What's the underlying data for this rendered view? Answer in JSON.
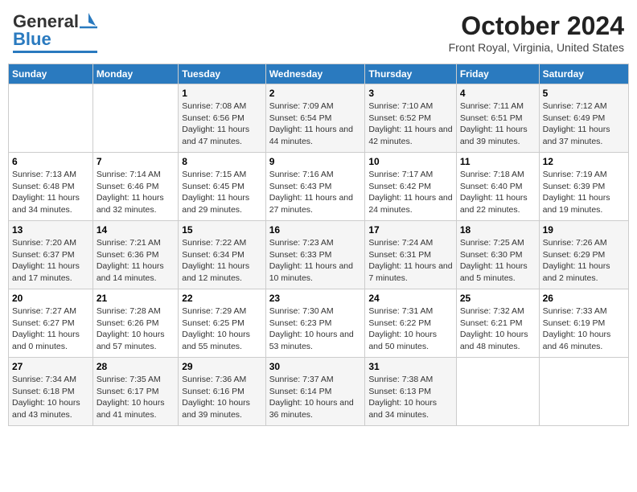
{
  "header": {
    "logo_line1": "General",
    "logo_line2": "Blue",
    "title": "October 2024",
    "subtitle": "Front Royal, Virginia, United States"
  },
  "days_of_week": [
    "Sunday",
    "Monday",
    "Tuesday",
    "Wednesday",
    "Thursday",
    "Friday",
    "Saturday"
  ],
  "weeks": [
    [
      {
        "num": "",
        "content": ""
      },
      {
        "num": "",
        "content": ""
      },
      {
        "num": "1",
        "content": "Sunrise: 7:08 AM\nSunset: 6:56 PM\nDaylight: 11 hours and 47 minutes."
      },
      {
        "num": "2",
        "content": "Sunrise: 7:09 AM\nSunset: 6:54 PM\nDaylight: 11 hours and 44 minutes."
      },
      {
        "num": "3",
        "content": "Sunrise: 7:10 AM\nSunset: 6:52 PM\nDaylight: 11 hours and 42 minutes."
      },
      {
        "num": "4",
        "content": "Sunrise: 7:11 AM\nSunset: 6:51 PM\nDaylight: 11 hours and 39 minutes."
      },
      {
        "num": "5",
        "content": "Sunrise: 7:12 AM\nSunset: 6:49 PM\nDaylight: 11 hours and 37 minutes."
      }
    ],
    [
      {
        "num": "6",
        "content": "Sunrise: 7:13 AM\nSunset: 6:48 PM\nDaylight: 11 hours and 34 minutes."
      },
      {
        "num": "7",
        "content": "Sunrise: 7:14 AM\nSunset: 6:46 PM\nDaylight: 11 hours and 32 minutes."
      },
      {
        "num": "8",
        "content": "Sunrise: 7:15 AM\nSunset: 6:45 PM\nDaylight: 11 hours and 29 minutes."
      },
      {
        "num": "9",
        "content": "Sunrise: 7:16 AM\nSunset: 6:43 PM\nDaylight: 11 hours and 27 minutes."
      },
      {
        "num": "10",
        "content": "Sunrise: 7:17 AM\nSunset: 6:42 PM\nDaylight: 11 hours and 24 minutes."
      },
      {
        "num": "11",
        "content": "Sunrise: 7:18 AM\nSunset: 6:40 PM\nDaylight: 11 hours and 22 minutes."
      },
      {
        "num": "12",
        "content": "Sunrise: 7:19 AM\nSunset: 6:39 PM\nDaylight: 11 hours and 19 minutes."
      }
    ],
    [
      {
        "num": "13",
        "content": "Sunrise: 7:20 AM\nSunset: 6:37 PM\nDaylight: 11 hours and 17 minutes."
      },
      {
        "num": "14",
        "content": "Sunrise: 7:21 AM\nSunset: 6:36 PM\nDaylight: 11 hours and 14 minutes."
      },
      {
        "num": "15",
        "content": "Sunrise: 7:22 AM\nSunset: 6:34 PM\nDaylight: 11 hours and 12 minutes."
      },
      {
        "num": "16",
        "content": "Sunrise: 7:23 AM\nSunset: 6:33 PM\nDaylight: 11 hours and 10 minutes."
      },
      {
        "num": "17",
        "content": "Sunrise: 7:24 AM\nSunset: 6:31 PM\nDaylight: 11 hours and 7 minutes."
      },
      {
        "num": "18",
        "content": "Sunrise: 7:25 AM\nSunset: 6:30 PM\nDaylight: 11 hours and 5 minutes."
      },
      {
        "num": "19",
        "content": "Sunrise: 7:26 AM\nSunset: 6:29 PM\nDaylight: 11 hours and 2 minutes."
      }
    ],
    [
      {
        "num": "20",
        "content": "Sunrise: 7:27 AM\nSunset: 6:27 PM\nDaylight: 11 hours and 0 minutes."
      },
      {
        "num": "21",
        "content": "Sunrise: 7:28 AM\nSunset: 6:26 PM\nDaylight: 10 hours and 57 minutes."
      },
      {
        "num": "22",
        "content": "Sunrise: 7:29 AM\nSunset: 6:25 PM\nDaylight: 10 hours and 55 minutes."
      },
      {
        "num": "23",
        "content": "Sunrise: 7:30 AM\nSunset: 6:23 PM\nDaylight: 10 hours and 53 minutes."
      },
      {
        "num": "24",
        "content": "Sunrise: 7:31 AM\nSunset: 6:22 PM\nDaylight: 10 hours and 50 minutes."
      },
      {
        "num": "25",
        "content": "Sunrise: 7:32 AM\nSunset: 6:21 PM\nDaylight: 10 hours and 48 minutes."
      },
      {
        "num": "26",
        "content": "Sunrise: 7:33 AM\nSunset: 6:19 PM\nDaylight: 10 hours and 46 minutes."
      }
    ],
    [
      {
        "num": "27",
        "content": "Sunrise: 7:34 AM\nSunset: 6:18 PM\nDaylight: 10 hours and 43 minutes."
      },
      {
        "num": "28",
        "content": "Sunrise: 7:35 AM\nSunset: 6:17 PM\nDaylight: 10 hours and 41 minutes."
      },
      {
        "num": "29",
        "content": "Sunrise: 7:36 AM\nSunset: 6:16 PM\nDaylight: 10 hours and 39 minutes."
      },
      {
        "num": "30",
        "content": "Sunrise: 7:37 AM\nSunset: 6:14 PM\nDaylight: 10 hours and 36 minutes."
      },
      {
        "num": "31",
        "content": "Sunrise: 7:38 AM\nSunset: 6:13 PM\nDaylight: 10 hours and 34 minutes."
      },
      {
        "num": "",
        "content": ""
      },
      {
        "num": "",
        "content": ""
      }
    ]
  ]
}
